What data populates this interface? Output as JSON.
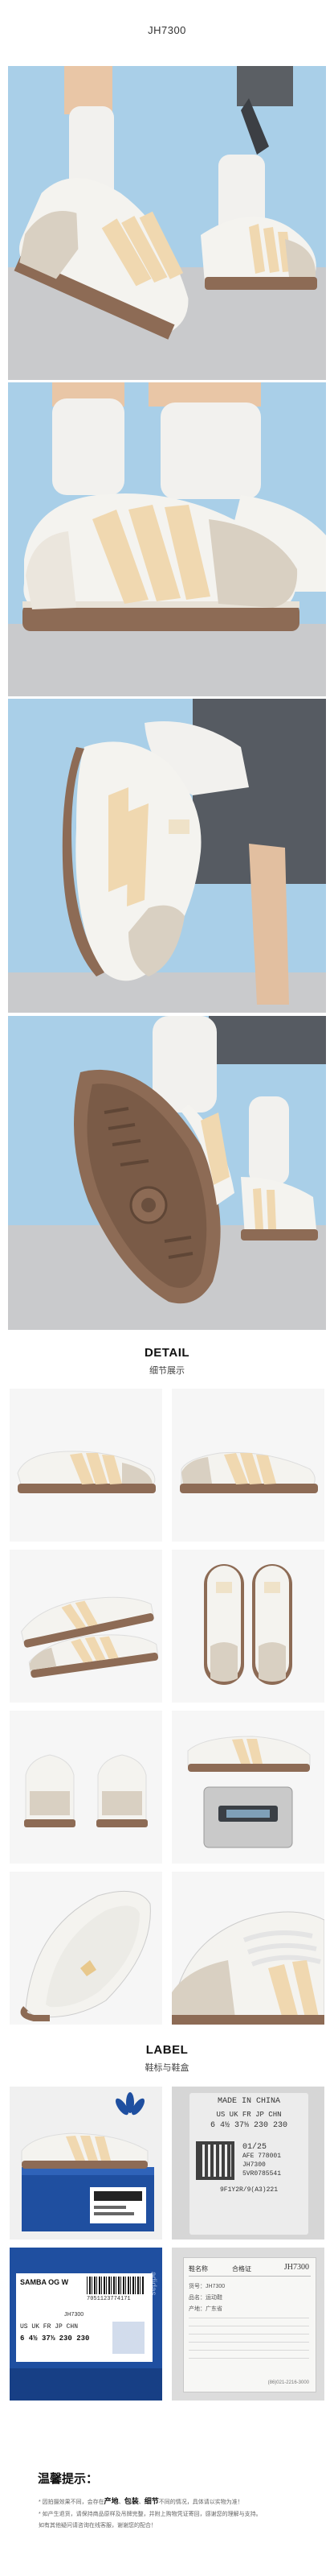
{
  "header": {
    "model_code": "JH7300"
  },
  "detail_section": {
    "title_en": "DETAIL",
    "title_cn": "细节展示"
  },
  "label_section": {
    "title_en": "LABEL",
    "title_cn": "鞋标与鞋盒"
  },
  "shoe_label": {
    "line1": "MADE IN CHINA",
    "header_row": "US  UK  FR  JP  CHN",
    "size_row": "6  4½  37⅓  230  230",
    "date": "01/25",
    "code1": "AFE 778001",
    "code2": "JH7300",
    "code3": "5VR0785541",
    "code4": "9F1Y2R/9(A3)221"
  },
  "box_label": {
    "brand": "adidas",
    "model_name": "SAMBA OG W",
    "article": "JH7300",
    "size_headers": "US  UK  FR  JP  CHN",
    "size_values": "6  4½  37⅓  230  230",
    "barcode_number": "7051123774171"
  },
  "cert_card": {
    "heading_left": "鞋名称",
    "heading_mid": "合格证",
    "heading_right": "JH7300",
    "line1": "货号：JH7300",
    "line2": "品名：运动鞋",
    "line3": "产地：广东省",
    "footer": "(86)021-2216-3000"
  },
  "notes": {
    "title": "温馨提示：",
    "line1_pre": "* 因拍摄效果不同，会存在",
    "line1_kw1": "产地",
    "line1_sep1": "、",
    "line1_kw2": "包装",
    "line1_sep2": "、",
    "line1_kw3": "细节",
    "line1_post": "不同的情况，具体请以实物为准！",
    "line2": "* 如产生退货，请保持商品原样及吊牌完整，并附上购物凭证寄回，感谢您的理解与支持。",
    "line3": "  如有其他疑问请咨询在线客服，谢谢您的配合！"
  },
  "colors": {
    "sky": "#a9cfe8",
    "ground": "#c9cacc",
    "leather": "#f4f3ef",
    "stripe": "#f0d8b0",
    "suede": "#d9d0c2",
    "gum": "#8d6b55",
    "sock": "#f2f1ee",
    "brand_blue": "#1f4fa0"
  },
  "icons": {
    "trefoil": "adidas-trefoil-icon",
    "barcode": "barcode-icon",
    "qr": "qr-code-icon"
  }
}
